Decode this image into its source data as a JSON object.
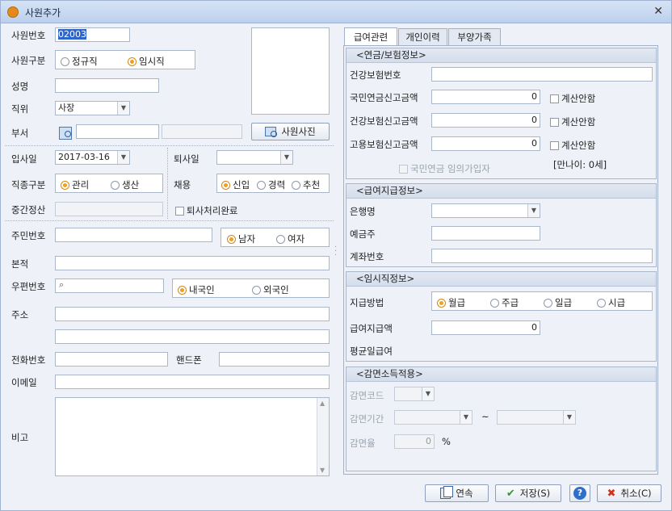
{
  "window": {
    "title": "사원추가"
  },
  "left": {
    "emp_no_label": "사원번호",
    "emp_no_value": "02003",
    "emp_type_label": "사원구분",
    "emp_type_opts": [
      "정규직",
      "임시직"
    ],
    "name_label": "성명",
    "name_value": "",
    "position_label": "직위",
    "position_value": "사장",
    "dept_label": "부서",
    "photo_button": "사원사진",
    "join_label": "입사일",
    "join_value": "2017-03-16",
    "leave_label": "퇴사일",
    "leave_value": "",
    "jobtype_label": "직종구분",
    "jobtype_opts": [
      "관리",
      "생산"
    ],
    "hire_label": "채용",
    "hire_opts": [
      "신입",
      "경력",
      "추천"
    ],
    "midcalc_label": "중간정산",
    "retire_done_label": "퇴사처리완료",
    "rrn_label": "주민번호",
    "gender_opts": [
      "남자",
      "여자"
    ],
    "origin_label": "본적",
    "zip_label": "우편번호",
    "nation_opts": [
      "내국인",
      "외국인"
    ],
    "address_label": "주소",
    "phone_label": "전화번호",
    "mobile_label": "핸드폰",
    "email_label": "이메일",
    "note_label": "비고"
  },
  "tabs": [
    "급여관련",
    "개인이력",
    "부양가족"
  ],
  "pension": {
    "title": "<연금/보험정보>",
    "health_no_label": "건강보험번호",
    "pension_amt_label": "국민연금신고금액",
    "pension_amt": "0",
    "health_amt_label": "건강보험신고금액",
    "health_amt": "0",
    "employ_amt_label": "고용보험신고금액",
    "employ_amt": "0",
    "no_calc": "계산안함",
    "voluntary_label": "국민연금 임의가입자",
    "age_label": "[만나이: 0세]"
  },
  "pay": {
    "title": "<급여지급정보>",
    "bank_label": "은행명",
    "holder_label": "예금주",
    "account_label": "계좌번호"
  },
  "temp": {
    "title": "<임시직정보>",
    "method_label": "지급방법",
    "method_opts": [
      "월급",
      "주급",
      "일급",
      "시급"
    ],
    "amount_label": "급여지급액",
    "amount": "0",
    "avg_label": "평균일급여"
  },
  "tax": {
    "title": "<감면소득적용>",
    "code_label": "감면코드",
    "period_label": "감면기간",
    "tilde": "~",
    "rate_label": "감면율",
    "rate": "0",
    "pct": "%"
  },
  "buttons": {
    "continue": "연속",
    "save": "저장(S)",
    "cancel": "취소(C)"
  }
}
